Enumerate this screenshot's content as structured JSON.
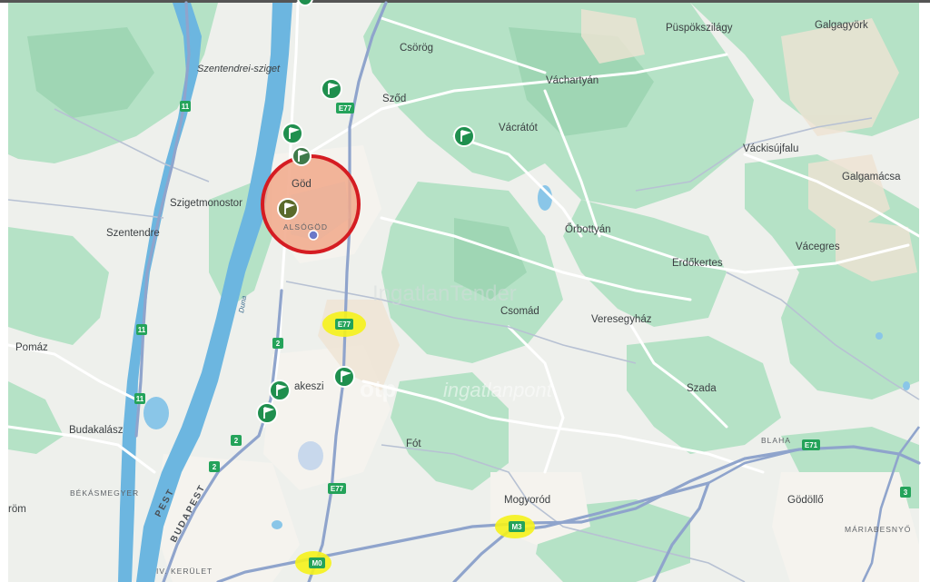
{
  "map": {
    "watermarks": {
      "primary": "IngatlanTender",
      "secondary_logo": "otp",
      "secondary_text": "ingatlanpont"
    },
    "colors": {
      "land": "#eef0ec",
      "green": "#b5e2c6",
      "water": "#6cb6e0",
      "road": "#ffffff",
      "motorway": "#8fa4cc",
      "shield": "#24a35a",
      "highlight": "#f5f21b",
      "circle_stroke": "#d51c22",
      "circle_fill": "#f1a88a",
      "poi": "#1f8f4e"
    },
    "places": {
      "csorog": "Csörög",
      "puspokszilagy": "Püspökszilágy",
      "galgagyork": "Galgagyörk",
      "szentendrei_sziget": "Szentendrei-sziget",
      "vacharlyan": "Váchartyán",
      "szod": "Sződ",
      "vacratot": "Vácrátót",
      "vackisujfalu": "Váckisújfalu",
      "galgamacsa": "Galgamácsa",
      "god": "Göd",
      "alsogod": "ALSÓGÖD",
      "szigetmonostor": "Szigetmonostor",
      "szentendre": "Szentendre",
      "orbottyan": "Őrbottyán",
      "vacegres": "Vácegres",
      "erdokertes": "Erdőkertes",
      "csomad": "Csomád",
      "veresegyhaz": "Veresegyház",
      "pomaz": "Pomáz",
      "fot_dakeszi": "akeszi",
      "duna": "Duna",
      "szada": "Szada",
      "budakalasz": "Budakalász",
      "fot": "Fót",
      "blaha": "BLAHA",
      "bekasmegyer": "BÉKÁSMEGYER",
      "mogyorod": "Mogyoród",
      "godollo": "Gödöllő",
      "uromo": "röm",
      "pest": "PEST",
      "budapest": "BUDAPEST",
      "mariabesnyo": "MÁRIABESNYŐ",
      "iv_kerulet": "IV. KERÜLET"
    },
    "shields": {
      "r11a": "11",
      "r11b": "11",
      "r11c": "11",
      "r2a": "2",
      "r2b": "2",
      "r2c": "2",
      "e77a": "E77",
      "e77b": "E77",
      "e77c": "E77",
      "e71": "E71",
      "m3": "M3",
      "m0": "M0",
      "r3": "3"
    },
    "highlighted_shields": [
      "E77",
      "M3",
      "M0"
    ]
  }
}
